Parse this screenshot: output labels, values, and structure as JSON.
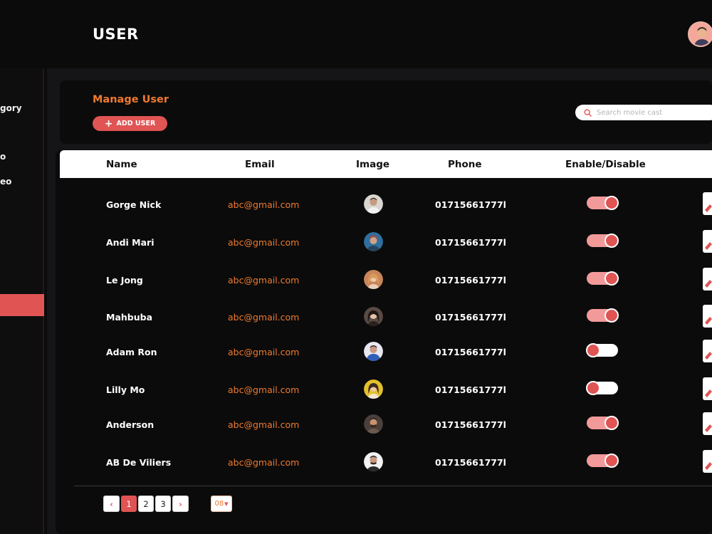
{
  "header": {
    "title": "USER"
  },
  "sidebar": {
    "items": [
      {
        "label": "gory"
      },
      {
        "label": "o"
      },
      {
        "label": "eo"
      }
    ]
  },
  "panel": {
    "title": "Manage User",
    "add_button_label": "ADD USER",
    "search_placeholder": "Search movie cast"
  },
  "table": {
    "columns": [
      "Name",
      "Email",
      "Image",
      "Phone",
      "Enable/Disable"
    ],
    "rows": [
      {
        "name": "Gorge Nick",
        "email": "abc@gmail.com",
        "phone": "01715661777l",
        "enabled": true
      },
      {
        "name": "Andi Mari",
        "email": "abc@gmail.com",
        "phone": "01715661777l",
        "enabled": true
      },
      {
        "name": "Le Jong",
        "email": "abc@gmail.com",
        "phone": "01715661777l",
        "enabled": true
      },
      {
        "name": "Mahbuba",
        "email": "abc@gmail.com",
        "phone": "01715661777l",
        "enabled": true
      },
      {
        "name": "Adam Ron",
        "email": "abc@gmail.com",
        "phone": "01715661777l",
        "enabled": false
      },
      {
        "name": "Lilly Mo",
        "email": "abc@gmail.com",
        "phone": "01715661777l",
        "enabled": false
      },
      {
        "name": "Anderson",
        "email": "abc@gmail.com",
        "phone": "01715661777l",
        "enabled": true
      },
      {
        "name": "AB De Viliers",
        "email": "abc@gmail.com",
        "phone": "01715661777l",
        "enabled": true
      }
    ]
  },
  "pagination": {
    "prev": "‹",
    "pages": [
      "1",
      "2",
      "3"
    ],
    "current": "1",
    "next": "›",
    "per_page": "08"
  },
  "colors": {
    "accent": "#e05454",
    "orange": "#f07a2e",
    "background": "#0b0b0b"
  }
}
